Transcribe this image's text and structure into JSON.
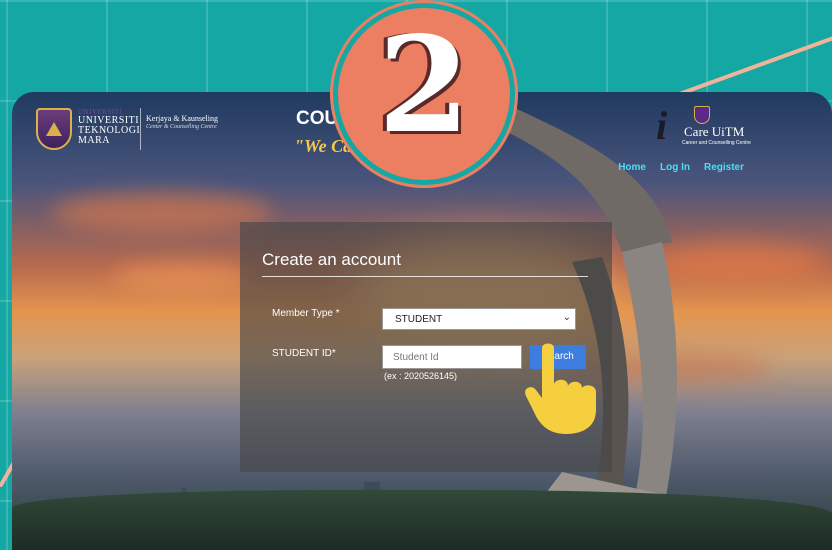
{
  "header": {
    "university": {
      "top": "UNIVERSITI",
      "line1": "UNIVERSITI",
      "line2": "TEKNOLOGI",
      "line3": "MARA"
    },
    "center": {
      "name": "Kerjaya & Kaunseling",
      "sub": "Center & Counselling Centre"
    },
    "site_title": "COU",
    "tagline": "\"We Ca",
    "icare": {
      "letter": "i",
      "title": "Care UiTM",
      "subtitle": "Career and Counselling Centre"
    }
  },
  "nav": {
    "home": "Home",
    "login": "Log In",
    "register": "Register"
  },
  "form": {
    "title": "Create an account",
    "member_type_label": "Member Type *",
    "member_type_value": "STUDENT",
    "student_id_label": "STUDENT ID*",
    "student_id_placeholder": "Student Id",
    "search_button": "Search",
    "hint": "(ex : 2020526145)"
  },
  "badge": {
    "step": "2"
  },
  "colors": {
    "teal": "#14a7a4",
    "badge": "#ec7f62",
    "nav": "#49e0f0",
    "button": "#3d7de0"
  }
}
